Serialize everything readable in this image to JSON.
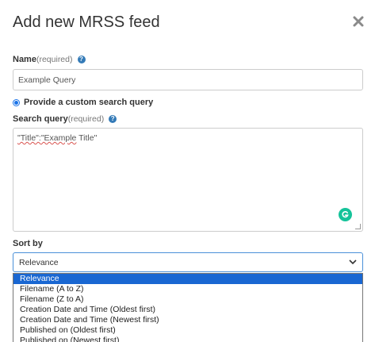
{
  "dialog": {
    "title": "Add new MRSS feed",
    "close_icon": "close-icon"
  },
  "name_field": {
    "label": "Name",
    "required": "(required)",
    "value": "Example Query",
    "help_icon": "help-icon"
  },
  "query_mode": {
    "label": "Provide a custom search query",
    "selected": true
  },
  "search_query": {
    "label": "Search query",
    "required": "(required)",
    "help_icon": "help-icon",
    "value_part1": "\"Title\":\"Example",
    "value_part2": " Title\""
  },
  "sort_by": {
    "label": "Sort by",
    "selected_value": "Relevance",
    "options": [
      "Relevance",
      "Filename (A to Z)",
      "Filename (Z to A)",
      "Creation Date and Time (Oldest first)",
      "Creation Date and Time (Newest first)",
      "Published on (Oldest first)",
      "Published on (Newest first)"
    ]
  },
  "colors": {
    "accent": "#1967d2",
    "help": "#337ab7",
    "grammarly": "#15c39a"
  }
}
